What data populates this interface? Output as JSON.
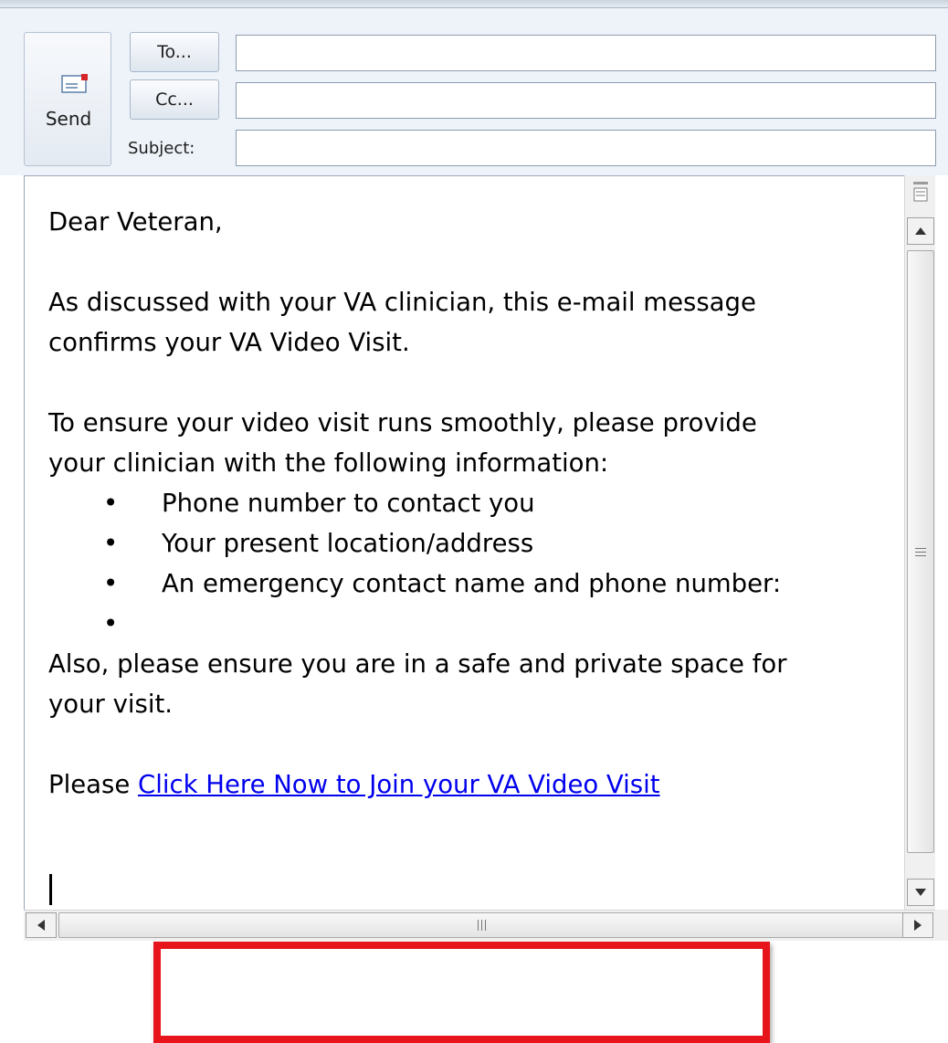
{
  "header": {
    "send_label": "Send",
    "to_button": "To...",
    "cc_button": "Cc...",
    "subject_label": "Subject:",
    "to_value": "",
    "cc_value": "",
    "subject_value": ""
  },
  "message": {
    "greeting": "Dear Veteran,",
    "para1_line1": "As discussed with your VA clinician, this e-mail message",
    "para1_line2": "confirms your VA Video Visit.",
    "para2_line1": "To ensure your video visit runs smoothly, please provide",
    "para2_line2": "your clinician with the following information:",
    "bullet_char": "•",
    "bullets": [
      "Phone number to contact you",
      "Your present location/address",
      "An emergency contact name and phone number:",
      ""
    ],
    "para3_line1": "Also, please ensure you are in a safe and private space for",
    "para3_line2": "your visit.",
    "please_prefix": "Please",
    "join_link": "Click Here Now to Join your VA Video Visit"
  },
  "colors": {
    "highlight": "#e8141c",
    "link": "#0000ee"
  },
  "icons": {
    "send": "envelope-send-icon",
    "split": "split-window-icon",
    "up": "scroll-up-arrow-icon",
    "down": "scroll-down-arrow-icon",
    "left": "scroll-left-arrow-icon",
    "right": "scroll-right-arrow-icon"
  }
}
